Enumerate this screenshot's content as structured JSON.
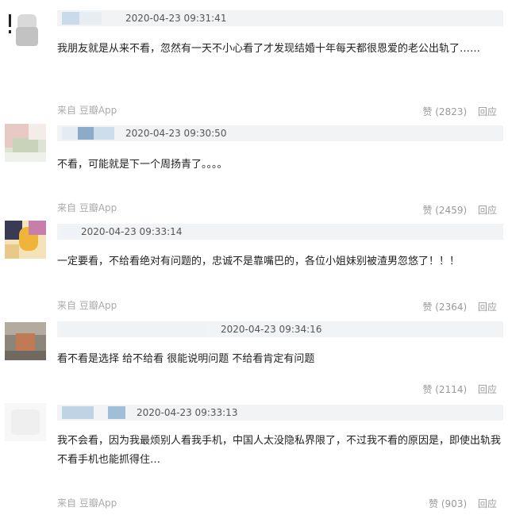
{
  "comments": [
    {
      "time": "2020-04-23 09:31:41",
      "text": "我朋友就是从来不看，忽然有一天不小心看了才发现结婚十年每天都很恩爱的老公出轨了……",
      "source": "来自 豆瓣App",
      "likes": "赞 (2823)",
      "reply": "回应"
    },
    {
      "time": "2020-04-23 09:30:50",
      "text": "不看，可能就是下一个周扬青了。。。。",
      "source": "来自 豆瓣App",
      "likes": "赞 (2459)",
      "reply": "回应"
    },
    {
      "time": "2020-04-23 09:33:14",
      "text": "一定要看，不给看绝对有问题的，忠诚不是靠嘴巴的，各位小姐妹别被渣男忽悠了！！！",
      "source": "来自 豆瓣App",
      "likes": "赞 (2364)",
      "reply": "回应"
    },
    {
      "time": "2020-04-23 09:34:16",
      "text": "看不看是选择 给不给看 很能说明问题 不给看肯定有问题",
      "source": "",
      "likes": "赞 (2114)",
      "reply": "回应"
    },
    {
      "time": "2020-04-23 09:33:13",
      "text": "我不会看，因为我最烦别人看我手机，中国人太没隐私界限了，不过我不看的原因是，即使出轨我不看手机也能抓得住…",
      "source": "来自 豆瓣App",
      "likes": "赞 (903)",
      "reply": "回应"
    }
  ]
}
